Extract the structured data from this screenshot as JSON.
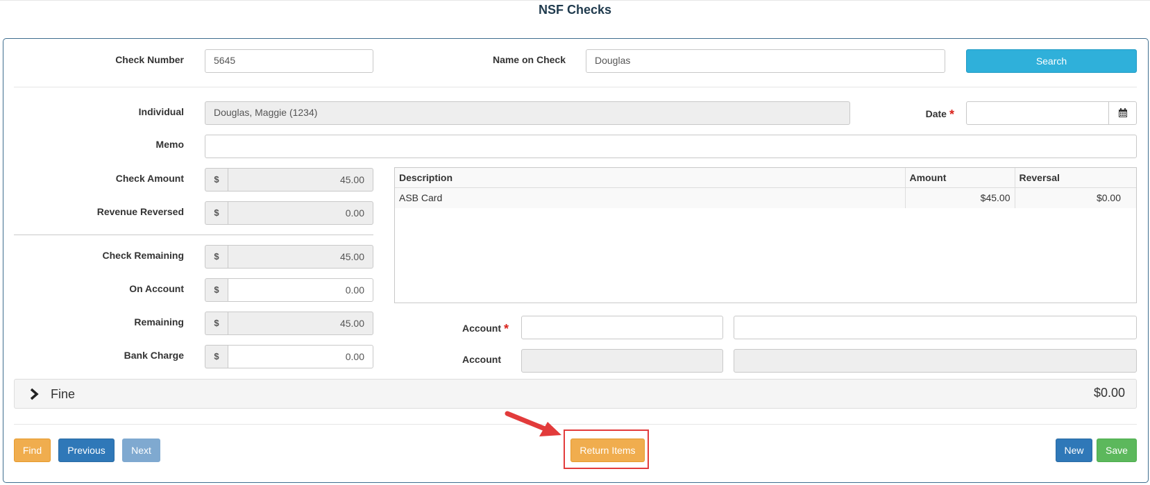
{
  "page": {
    "title": "NSF Checks"
  },
  "search": {
    "check_number_label": "Check Number",
    "check_number_value": "5645",
    "name_label": "Name on Check",
    "name_value": "Douglas",
    "search_button": "Search"
  },
  "form": {
    "individual_label": "Individual",
    "individual_value": "Douglas, Maggie (1234)",
    "date_label": "Date",
    "date_value": "",
    "required_mark": "*",
    "memo_label": "Memo",
    "memo_value": "",
    "currency_symbol": "$",
    "check_amount_label": "Check Amount",
    "check_amount_value": "45.00",
    "revenue_reversed_label": "Revenue Reversed",
    "revenue_reversed_value": "0.00",
    "check_remaining_label": "Check Remaining",
    "check_remaining_value": "45.00",
    "on_account_label": "On Account",
    "on_account_value": "0.00",
    "remaining_label": "Remaining",
    "remaining_value": "45.00",
    "bank_charge_label": "Bank Charge",
    "bank_charge_value": "0.00",
    "account1_label": "Account",
    "account1_code": "",
    "account1_name": "",
    "account2_label": "Account",
    "account2_code": "",
    "account2_name": ""
  },
  "items_table": {
    "headers": {
      "description": "Description",
      "amount": "Amount",
      "reversal": "Reversal"
    },
    "rows": [
      {
        "description": "ASB Card",
        "amount": "$45.00",
        "reversal": "$0.00"
      }
    ]
  },
  "fine": {
    "title": "Fine",
    "amount": "$0.00"
  },
  "footer": {
    "find": "Find",
    "previous": "Previous",
    "next": "Next",
    "return_items": "Return Items",
    "new": "New",
    "save": "Save"
  },
  "colors": {
    "search_button": "#2fb0da",
    "warning": "#f0ad4e",
    "primary": "#2f78b8",
    "success": "#5cb85c",
    "annotation": "#e23b3b"
  },
  "icons": [
    "calendar-icon",
    "chevron-right-icon",
    "annotation-arrow"
  ]
}
